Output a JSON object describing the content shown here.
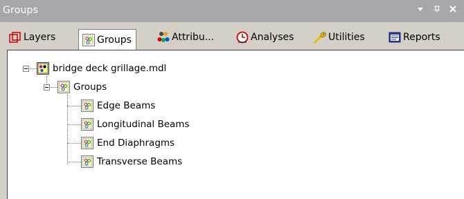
{
  "window": {
    "title": "Groups",
    "controls": [
      "▾",
      "ᵖ",
      "×"
    ]
  },
  "tabs": [
    {
      "label": "Layers",
      "icon": "layers-icon",
      "active": false
    },
    {
      "label": "Groups",
      "icon": "groups-icon",
      "active": true
    },
    {
      "label": "Attribu...",
      "icon": "attributes-icon",
      "active": false
    },
    {
      "label": "Analyses",
      "icon": "analyses-icon",
      "active": false
    },
    {
      "label": "Utilities",
      "icon": "utilities-icon",
      "active": false
    },
    {
      "label": "Reports",
      "icon": "reports-icon",
      "active": false
    }
  ],
  "tree": {
    "root": {
      "label": "bridge deck grillage.mdl"
    },
    "group_folder": {
      "label": "Groups"
    },
    "items": [
      {
        "label": "Edge Beams"
      },
      {
        "label": "Longitudinal Beams"
      },
      {
        "label": "End Diaphragms"
      },
      {
        "label": "Transverse Beams"
      }
    ]
  },
  "colors": {
    "titlebar": "#a7a6aa",
    "panel": "#ffffff",
    "chrome": "#d4d0c8"
  }
}
